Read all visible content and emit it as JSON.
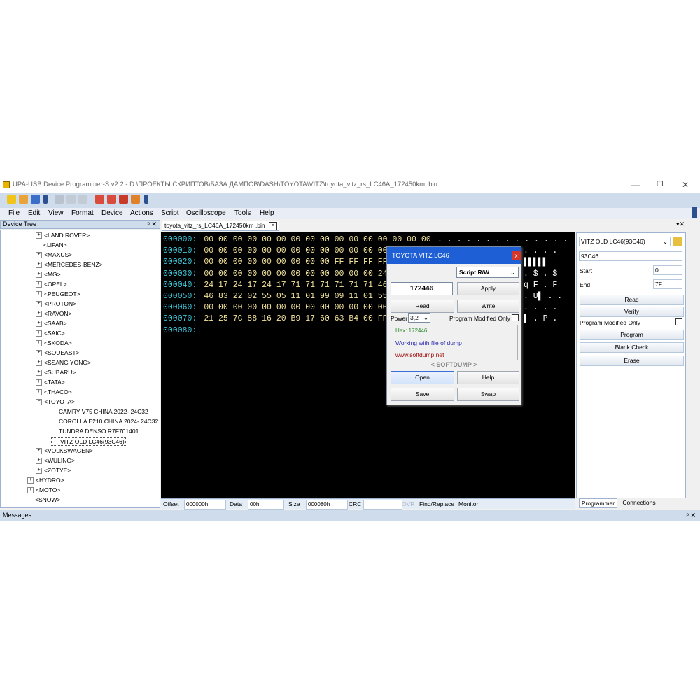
{
  "window": {
    "title": "UPA-USB Device Programmer-S v2.2 - D:\\ПРОЕКТЫ СКРИПТОВ\\БАЗА ДАМПОВ\\DASH\\TOYOTA\\VITZ\\toyota_vitz_rs_LC46A_172450km .bin",
    "controls": {
      "minimize": "—",
      "restore": "❐",
      "close": "✕"
    }
  },
  "menu": [
    "File",
    "Edit",
    "View",
    "Format",
    "Device",
    "Actions",
    "Script",
    "Oscilloscope",
    "Tools",
    "Help"
  ],
  "device_tree": {
    "header": "Device Tree",
    "header_controls": "ᵖ ✕",
    "items": [
      {
        "label": "<LAND ROVER>",
        "level": 1,
        "expander": "+"
      },
      {
        "label": "<LIFAN>",
        "level": 1,
        "expander": ""
      },
      {
        "label": "<MAXUS>",
        "level": 1,
        "expander": "+"
      },
      {
        "label": "<MERCEDES-BENZ>",
        "level": 1,
        "expander": "+"
      },
      {
        "label": "<MG>",
        "level": 1,
        "expander": "+"
      },
      {
        "label": "<OPEL>",
        "level": 1,
        "expander": "+"
      },
      {
        "label": "<PEUGEOT>",
        "level": 1,
        "expander": "+"
      },
      {
        "label": "<PROTON>",
        "level": 1,
        "expander": "+"
      },
      {
        "label": "<RAVON>",
        "level": 1,
        "expander": "+"
      },
      {
        "label": "<SAAB>",
        "level": 1,
        "expander": "+"
      },
      {
        "label": "<SAIC>",
        "level": 1,
        "expander": "+"
      },
      {
        "label": "<SKODA>",
        "level": 1,
        "expander": "+"
      },
      {
        "label": "<SOUEAST>",
        "level": 1,
        "expander": "+"
      },
      {
        "label": "<SSANG YONG>",
        "level": 1,
        "expander": "+"
      },
      {
        "label": "<SUBARU>",
        "level": 1,
        "expander": "+"
      },
      {
        "label": "<TATA>",
        "level": 1,
        "expander": "+"
      },
      {
        "label": "<THACO>",
        "level": 1,
        "expander": "+"
      },
      {
        "label": "<TOYOTA>",
        "level": 1,
        "expander": "−"
      },
      {
        "label": "CAMRY V75 CHINA 2022- 24C32",
        "level": 2,
        "expander": ""
      },
      {
        "label": "COROLLA E210 CHINA 2024- 24C32",
        "level": 2,
        "expander": ""
      },
      {
        "label": "TUNDRA DENSO R7F701401",
        "level": 2,
        "expander": ""
      },
      {
        "label": "VITZ OLD LC46(93C46)",
        "level": 2,
        "expander": "",
        "selected": true
      },
      {
        "label": "<VOLKSWAGEN>",
        "level": 1,
        "expander": "+"
      },
      {
        "label": "<WULING>",
        "level": 1,
        "expander": "+"
      },
      {
        "label": "<ZOTYE>",
        "level": 1,
        "expander": "+"
      },
      {
        "label": "<HYDRO>",
        "level": 0,
        "expander": "+"
      },
      {
        "label": "<MOTO>",
        "level": 0,
        "expander": "+"
      },
      {
        "label": "<SNOW>",
        "level": 0,
        "expander": ""
      }
    ]
  },
  "editor": {
    "tab_label": "toyota_vitz_rs_LC46A_172450km .bin",
    "tab_close": "✕",
    "hex_lines": [
      {
        "addr": "000000:",
        "bytes": "00 00 00 00 00 00 00 00 00 00 00 00 00 00 00 00",
        "ascii": ". . . . . . . . . . . . . . . ."
      },
      {
        "addr": "000010:",
        "bytes": "00 00 00 00 00 00 00 00 00 00 00 00 00",
        "ascii": ". . . ."
      },
      {
        "addr": "000020:",
        "bytes": "00 00 00 00 00 00 00 00 00 FF FF FF FF",
        "ascii": "▌▌▌▌▌"
      },
      {
        "addr": "000030:",
        "bytes": "00 00 00 00 00 00 00 00 00 00 00 00 24",
        "ascii": ". $ . $"
      },
      {
        "addr": "000040:",
        "bytes": "24 17 24 17 24 17 71 71 71 71 71 71 46",
        "ascii": "q F . F"
      },
      {
        "addr": "000050:",
        "bytes": "46 83 22 02 55 05 11 01 99 09 11 01 55",
        "ascii": ". U▌ . ."
      },
      {
        "addr": "000060:",
        "bytes": "00 00 00 00 00 00 00 00 00 00 00 00 00",
        "ascii": ". . . ."
      },
      {
        "addr": "000070:",
        "bytes": "21 25 7C 88 16 20 B9 17 60 63 B4 00 FF",
        "ascii": "▌ . P ."
      },
      {
        "addr": "000080:",
        "bytes": "",
        "ascii": ""
      }
    ],
    "status": {
      "offset_label": "Offset",
      "offset_value": "000000h",
      "data_label": "Data",
      "data_value": "00h",
      "size_label": "Size",
      "size_value": "000080h",
      "crc_label": "CRC",
      "crc_value": "",
      "ovr": "OVR",
      "find_replace": "Find/Replace",
      "monitor": "Monitor"
    }
  },
  "right_panel": {
    "header_controls": "▾✕",
    "device_select": "VITZ OLD LC46(93C46)",
    "chip": "93C46",
    "start_label": "Start",
    "start_value": "0",
    "end_label": "End",
    "end_value": "7F",
    "read": "Read",
    "verify": "Verify",
    "program_modified_only": "Program Modified Only",
    "program": "Program",
    "blank_check": "Blank Check",
    "erase": "Erase",
    "tabs": [
      "Programmer",
      "Connections"
    ]
  },
  "dialog": {
    "title": "TOYOTA VITZ LC46",
    "close": "x",
    "script_select": "Script R/W",
    "value": "172446",
    "apply": "Apply",
    "read": "Read",
    "write": "Write",
    "power_label": "Power",
    "power_value": "3,2",
    "program_modified_only": "Program Modified Only",
    "info_hex": "Hex: 172446",
    "info_working": "Working with file of dump",
    "info_site": "www.softdump.net",
    "brand": "< SOFTDUMP >",
    "open": "Open",
    "help": "Help",
    "save": "Save",
    "swap": "Swap"
  },
  "bottom": {
    "messages_label": "Messages",
    "controls": "ᵖ ✕"
  },
  "colors": {
    "accent_blue": "#1e5fd6",
    "hex_addr": "#3cc6d8",
    "hex_bytes": "#f2e39b",
    "info_green": "#2a8a2a",
    "info_blue": "#2a2ab0",
    "info_red": "#a01010"
  }
}
